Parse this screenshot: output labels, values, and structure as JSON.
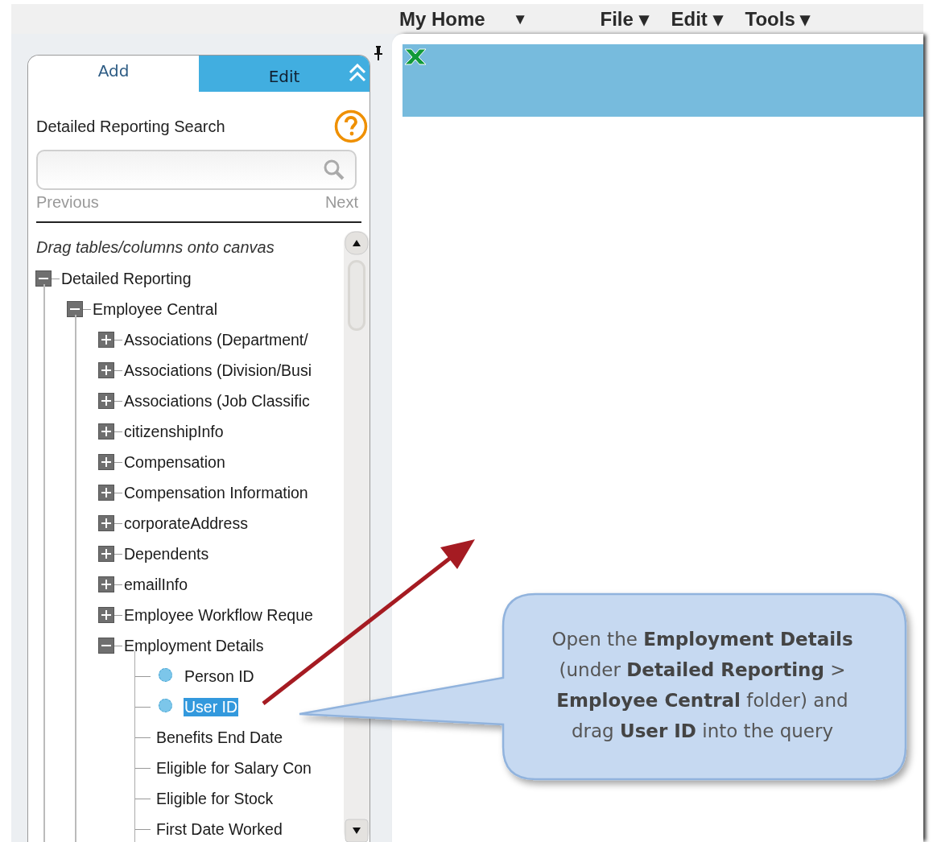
{
  "menu": {
    "home": {
      "label": "My Home",
      "caret": "▼"
    },
    "items": [
      "File ▾",
      "Edit ▾",
      "Tools ▾"
    ]
  },
  "panel": {
    "tabs": [
      {
        "label": "Add",
        "selected": true
      },
      {
        "label": "Edit",
        "selected": false
      }
    ],
    "heading": "Detailed Reporting Search",
    "previous": {
      "label": "Previous",
      "disabled": true
    },
    "next": {
      "label": "Next",
      "disabled": true
    },
    "hint": "Drag tables/columns onto canvas",
    "tree": [
      {
        "label": "Detailed Reporting",
        "kind": "folder",
        "expanded": true,
        "selected": false,
        "children": [
          {
            "label": "Employee Central",
            "kind": "folder",
            "expanded": true,
            "selected": false,
            "children": [
              {
                "label": "Associations (Department/",
                "kind": "folder",
                "expanded": false,
                "selected": false
              },
              {
                "label": "Associations (Division/Busi",
                "kind": "folder",
                "expanded": false,
                "selected": false
              },
              {
                "label": "Associations (Job Classific",
                "kind": "folder",
                "expanded": false,
                "selected": false
              },
              {
                "label": "citizenshipInfo",
                "kind": "folder",
                "expanded": false,
                "selected": false
              },
              {
                "label": "Compensation",
                "kind": "folder",
                "expanded": false,
                "selected": false
              },
              {
                "label": "Compensation Information",
                "kind": "folder",
                "expanded": false,
                "selected": false
              },
              {
                "label": "corporateAddress",
                "kind": "folder",
                "expanded": false,
                "selected": false
              },
              {
                "label": "Dependents",
                "kind": "folder",
                "expanded": false,
                "selected": false
              },
              {
                "label": "emailInfo",
                "kind": "folder",
                "expanded": false,
                "selected": false
              },
              {
                "label": "Employee Workflow Reque",
                "kind": "folder",
                "expanded": false,
                "selected": false
              },
              {
                "label": "Employment Details",
                "kind": "folder",
                "expanded": true,
                "selected": false,
                "children": [
                  {
                    "label": "Person ID",
                    "kind": "field",
                    "selected": false
                  },
                  {
                    "label": "User ID",
                    "kind": "field",
                    "selected": true
                  },
                  {
                    "label": "Benefits End Date",
                    "kind": "column",
                    "selected": false
                  },
                  {
                    "label": "Eligible for Salary Con",
                    "kind": "column",
                    "selected": false
                  },
                  {
                    "label": "Eligible for Stock",
                    "kind": "column",
                    "selected": false
                  },
                  {
                    "label": "First Date Worked",
                    "kind": "column",
                    "selected": false
                  }
                ]
              }
            ]
          }
        ]
      }
    ]
  },
  "callout": {
    "text": "Open the **Employment Details** (under **Detailed Reporting** > **Employee Central** folder) and drag **User ID** into the query"
  }
}
